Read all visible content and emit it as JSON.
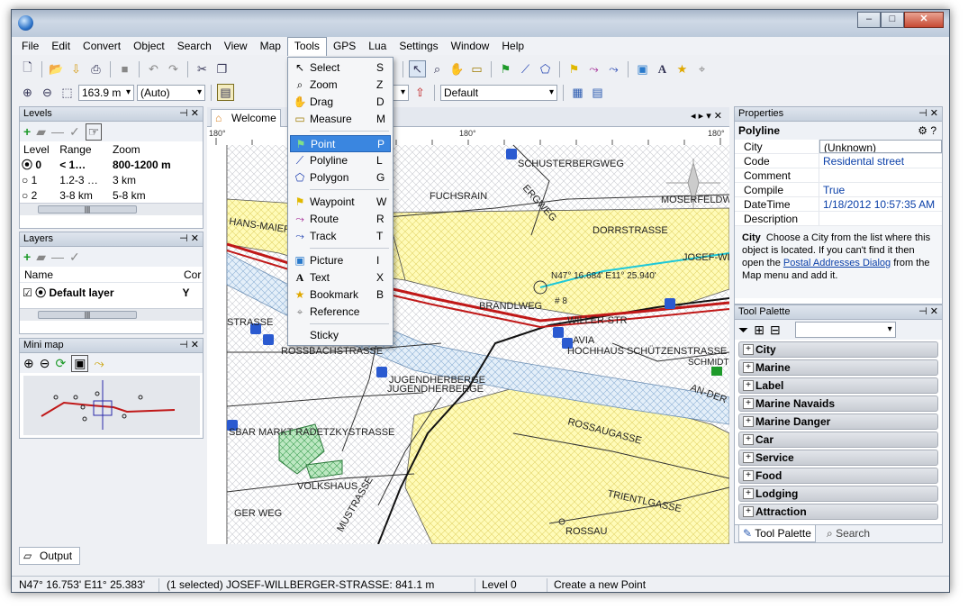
{
  "window": {
    "controls": {
      "minimize": "–",
      "maximize": "□",
      "close": "✕"
    }
  },
  "menu": [
    "File",
    "Edit",
    "Convert",
    "Object",
    "Search",
    "View",
    "Map",
    "Tools",
    "GPS",
    "Lua",
    "Settings",
    "Window",
    "Help"
  ],
  "toolbar": {
    "scale_value": "163.9 m",
    "zoom_mode": "(Auto)",
    "style_value": "Default"
  },
  "tools_menu": [
    {
      "icon": "select-icon",
      "glyph": "↖",
      "label": "Select",
      "shortcut": "S"
    },
    {
      "icon": "zoom-icon",
      "glyph": "⌕",
      "label": "Zoom",
      "shortcut": "Z"
    },
    {
      "icon": "drag-hand-icon",
      "glyph": "✋",
      "label": "Drag",
      "shortcut": "D"
    },
    {
      "icon": "measure-icon",
      "glyph": "▭",
      "label": "Measure",
      "shortcut": "M"
    },
    {
      "icon": "point-flag-icon",
      "glyph": "⚑",
      "label": "Point",
      "shortcut": "P",
      "highlighted": true
    },
    {
      "icon": "polyline-icon",
      "glyph": "⟋",
      "label": "Polyline",
      "shortcut": "L"
    },
    {
      "icon": "polygon-icon",
      "glyph": "⬠",
      "label": "Polygon",
      "shortcut": "G"
    },
    {
      "icon": "waypoint-icon",
      "glyph": "⚑",
      "label": "Waypoint",
      "shortcut": "W"
    },
    {
      "icon": "route-icon",
      "glyph": "⤳",
      "label": "Route",
      "shortcut": "R"
    },
    {
      "icon": "track-icon",
      "glyph": "⤳",
      "label": "Track",
      "shortcut": "T"
    },
    {
      "icon": "picture-icon",
      "glyph": "▣",
      "label": "Picture",
      "shortcut": "I"
    },
    {
      "icon": "text-icon",
      "glyph": "A",
      "label": "Text",
      "shortcut": "X"
    },
    {
      "icon": "bookmark-star-icon",
      "glyph": "★",
      "label": "Bookmark",
      "shortcut": "B"
    },
    {
      "icon": "reference-icon",
      "glyph": "⌖",
      "label": "Reference",
      "shortcut": ""
    },
    {
      "icon": "",
      "glyph": "",
      "label": "Sticky",
      "shortcut": ""
    }
  ],
  "levels": {
    "title": "Levels",
    "columns": [
      "Level",
      "Range",
      "Zoom"
    ],
    "rows": [
      {
        "level": "0",
        "range": "< 1…",
        "zoom": "800-1200 m",
        "selected": true
      },
      {
        "level": "1",
        "range": "1.2-3 …",
        "zoom": "3 km",
        "selected": false
      },
      {
        "level": "2",
        "range": "3-8 km",
        "zoom": "5-8 km",
        "selected": false
      }
    ]
  },
  "layers": {
    "title": "Layers",
    "columns": [
      "Name",
      "Cor"
    ],
    "rows": [
      {
        "name": "Default layer",
        "extra": "Y"
      }
    ]
  },
  "minimap": {
    "title": "Mini map"
  },
  "document": {
    "tab_label": "Welcome",
    "ruler_left": "180°",
    "ruler_mid": "180°",
    "ruler_right": "180°"
  },
  "map_labels": [
    "SCHUSTERBERGWEG",
    "FUCHSRAIN",
    "HANS-MAIER",
    "DORRSTRASSE",
    "MOSERFELDW",
    "JOSEF-WIL",
    "N47° 16.684' E11° 25.940'",
    "BRANDLWEG",
    "# 8",
    "WILLER-STR",
    "AVIA",
    "HOCHHAUS SCHÜTZENSTRASSE",
    "ROSSBACHSTRASSE",
    "JUGENDHERBERGE",
    "JUGENDHERBERGE",
    "SBAR MARKT RADETZKYSTRASSE",
    "VOLKSHAUS",
    "ROSSAUGASSE",
    "TRIENTLGASSE",
    "ROSSAU",
    "AN-DER",
    "ERGWEG",
    "STRASSE",
    "MUSTRASSE",
    "GER WEG",
    "ZIGSTRASSE",
    "SCHMIDT"
  ],
  "properties": {
    "title": "Properties",
    "object_type": "Polyline",
    "rows": [
      {
        "key": "City",
        "value": "(Unknown)"
      },
      {
        "key": "Code",
        "value": "Residental street"
      },
      {
        "key": "Comment",
        "value": ""
      },
      {
        "key": "Compile",
        "value": "True"
      },
      {
        "key": "DateTime",
        "value": "1/18/2012 10:57:35 AM"
      },
      {
        "key": "Description",
        "value": ""
      }
    ],
    "help_title": "City",
    "help_text_1": "Choose a City from the list where this object is located. If you can't find it then open the",
    "help_link": "Postal Addresses Dialog",
    "help_text_2": "from the Map menu and add it."
  },
  "tool_palette": {
    "title": "Tool Palette",
    "categories": [
      "City",
      "Marine",
      "Label",
      "Marine Navaids",
      "Marine Danger",
      "Car",
      "Service",
      "Food",
      "Lodging",
      "Attraction"
    ],
    "tabs": [
      "Tool Palette",
      "Search"
    ]
  },
  "output_tab": "Output",
  "status": {
    "coords": "N47° 16.753' E11° 25.383'",
    "selection": "(1 selected) JOSEF-WILLBERGER-STRASSE: 841.1 m",
    "level": "Level 0",
    "hint": "Create a new Point"
  }
}
